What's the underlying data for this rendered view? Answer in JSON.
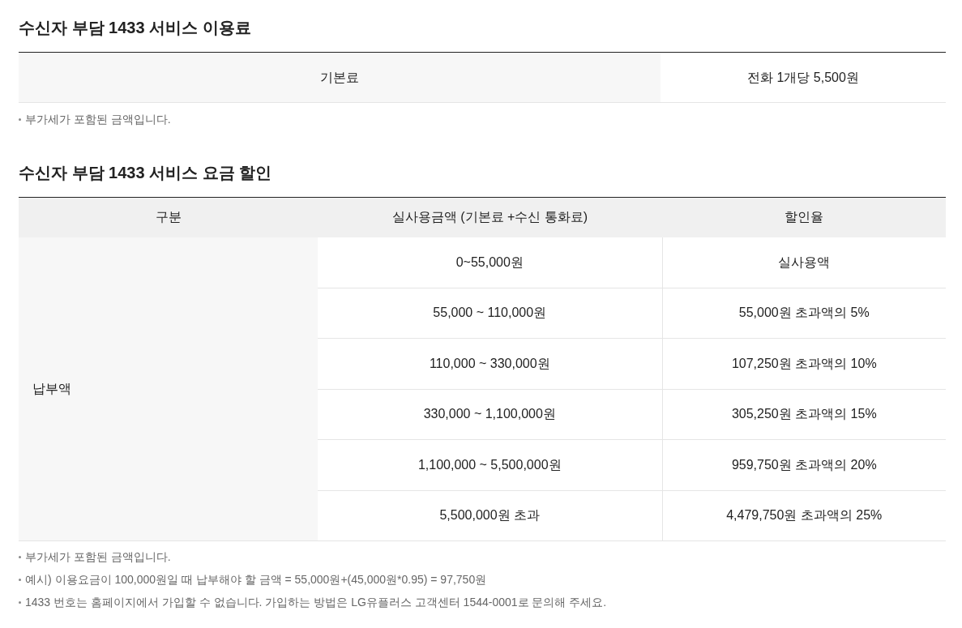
{
  "fee_section": {
    "title": "수신자 부담 1433 서비스 이용료",
    "label": "기본료",
    "value": "전화 1개당 5,500원",
    "notes": [
      "부가세가 포함된 금액입니다."
    ]
  },
  "discount_section": {
    "title": "수신자 부담 1433 서비스 요금 할인",
    "columns": [
      "구분",
      "실사용금액 (기본료 +수신 통화료)",
      "할인율"
    ],
    "group_label": "납부액",
    "rows": [
      {
        "amount": "0~55,000원",
        "rate": "실사용액"
      },
      {
        "amount": "55,000 ~ 110,000원",
        "rate": "55,000원 초과액의 5%"
      },
      {
        "amount": "110,000 ~ 330,000원",
        "rate": "107,250원 초과액의 10%"
      },
      {
        "amount": "330,000 ~ 1,100,000원",
        "rate": "305,250원 초과액의 15%"
      },
      {
        "amount": "1,100,000 ~ 5,500,000원",
        "rate": "959,750원 초과액의 20%"
      },
      {
        "amount": "5,500,000원 초과",
        "rate": "4,479,750원 초과액의 25%"
      }
    ],
    "notes": [
      "부가세가 포함된 금액입니다.",
      "예시) 이용요금이 100,000원일 때 납부해야 할 금액 = 55,000원+(45,000원*0.95) = 97,750원",
      "1433 번호는 홈페이지에서 가입할 수 없습니다. 가입하는 방법은 LG유플러스 고객센터 1544-0001로 문의해 주세요."
    ]
  }
}
